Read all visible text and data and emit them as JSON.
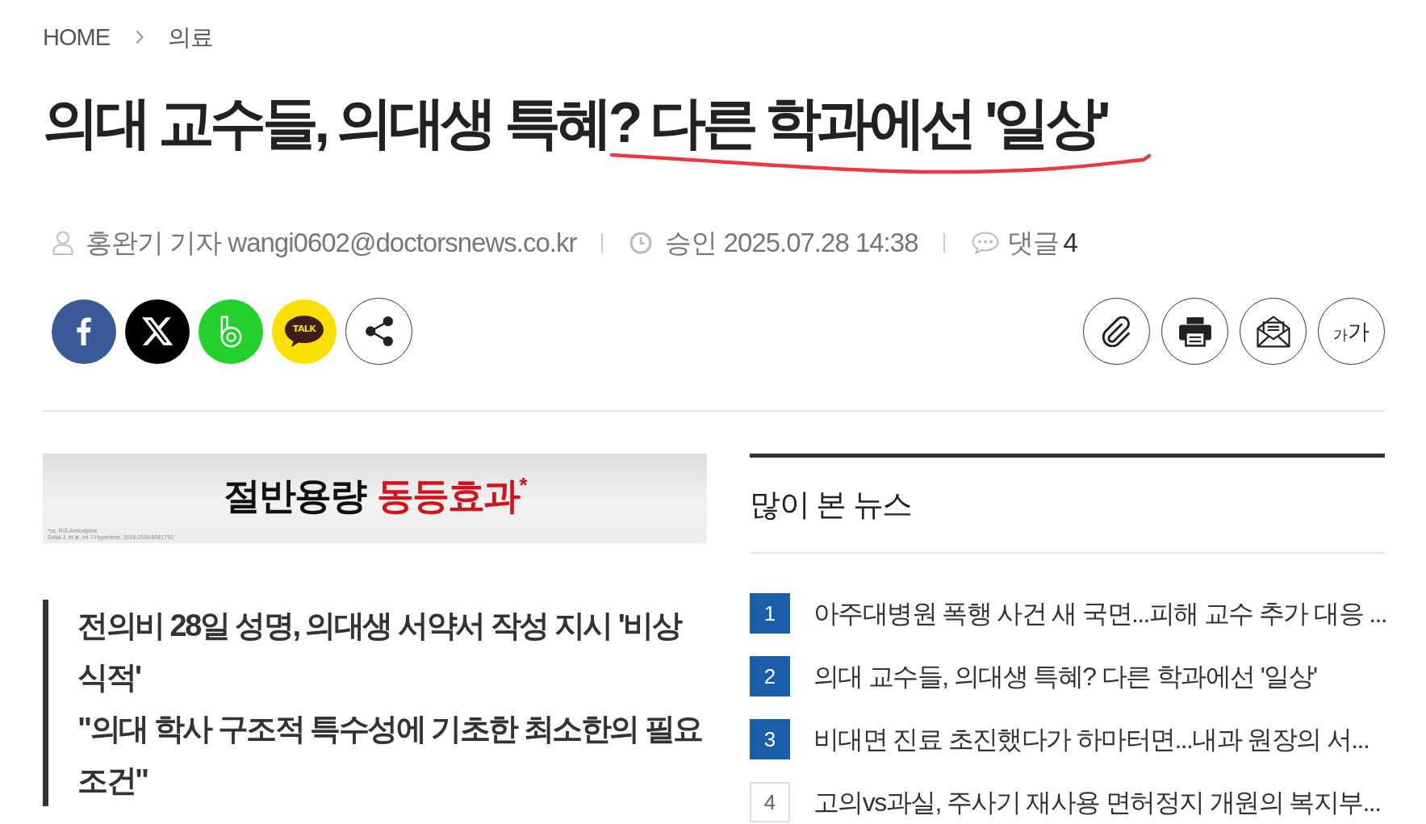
{
  "breadcrumb": [
    {
      "label": "HOME"
    },
    {
      "label": "의료"
    }
  ],
  "article": {
    "title": "의대 교수들, 의대생 특혜? 다른 학과에선 '일상'",
    "annotation": {
      "kind": "underline"
    },
    "byline": "홍완기 기자 wangi0602@doctorsnews.co.kr",
    "approved": "승인 2025.07.28 14:38",
    "comments": {
      "label": "댓글",
      "count": "4"
    }
  },
  "share_buttons": [
    {
      "kind": "facebook"
    },
    {
      "kind": "x"
    },
    {
      "kind": "band"
    },
    {
      "kind": "kakaotalk",
      "label": "TALK"
    },
    {
      "kind": "share"
    }
  ],
  "tool_buttons": [
    {
      "kind": "attach"
    },
    {
      "kind": "print"
    },
    {
      "kind": "email"
    },
    {
      "kind": "font_size",
      "small": "가",
      "large": "가"
    }
  ],
  "ad_banner": {
    "text": "절반용량",
    "highlight": "동등효과$^{*}$",
    "footnotes": [
      "*vs. R/S Amlodipine",
      "Datal J, et al. Int J Hypertens. 2016;2016:8061792"
    ]
  },
  "subtitle": [
    "전의비 28일 성명, 의대생 서약서 작성 지시 '비상식적'",
    "\"의대 학사 구조적 특수성에 기초한 최소한의 필요조건\""
  ],
  "popular_news": {
    "title": "많이 본 뉴스",
    "items": [
      {
        "rank": "1",
        "title": "아주대병원 폭행 사건 새 국면...피해 교수 추가 대응 ...",
        "highlighted": true
      },
      {
        "rank": "2",
        "title": "의대 교수들, 의대생 특혜? 다른 학과에선 '일상'",
        "highlighted": true
      },
      {
        "rank": "3",
        "title": "비대면 진료 초진했다가 하마터면...내과 원장의 서...",
        "highlighted": true
      },
      {
        "rank": "4",
        "title": "고의vs과실, 주사기 재사용 면허정지 개원의 복지부...",
        "highlighted": false
      }
    ]
  }
}
